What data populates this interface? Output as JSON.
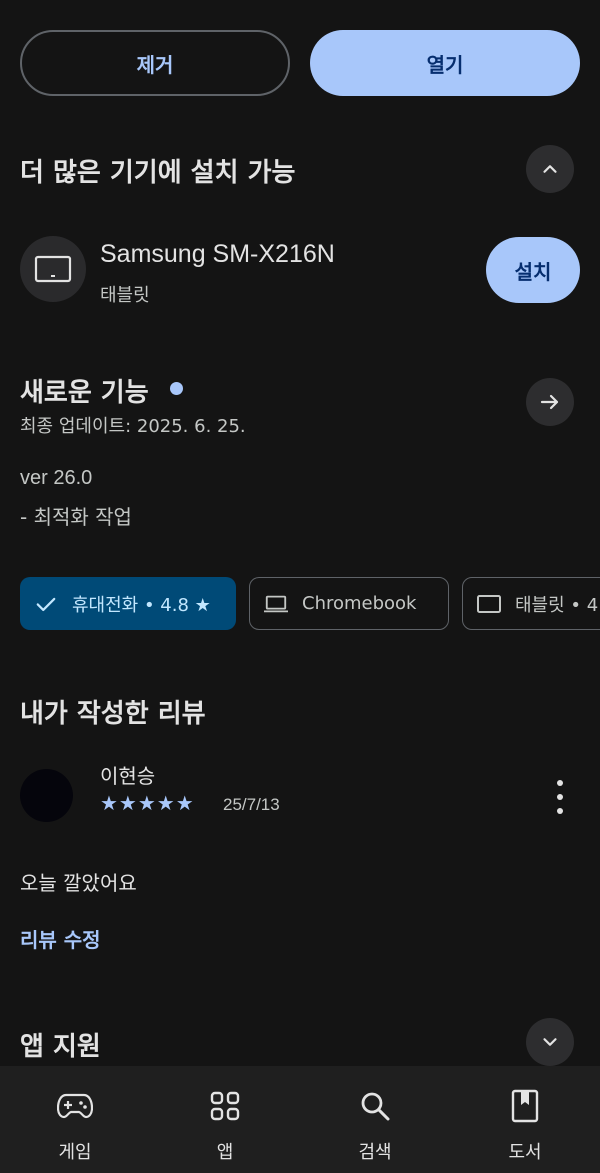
{
  "actions": {
    "remove_label": "제거",
    "open_label": "열기"
  },
  "more_devices": {
    "title": "더 많은 기기에 설치 가능",
    "device": {
      "name": "Samsung SM-X216N",
      "type": "태블릿",
      "install_label": "설치"
    }
  },
  "whats_new": {
    "title": "새로운 기능",
    "updated": "최종 업데이트: 2025. 6. 25.",
    "version": "ver 26.0",
    "note": "- 최적화 작업"
  },
  "rating_chips": [
    {
      "label": "휴대전화 • 4.8 ★",
      "icon": "check-icon",
      "selected": true
    },
    {
      "label": "Chromebook",
      "icon": "laptop-icon",
      "selected": false
    },
    {
      "label": "태블릿 • 4.",
      "icon": "tablet-icon",
      "selected": false
    }
  ],
  "my_review": {
    "title": "내가 작성한 리뷰",
    "author": "이현승",
    "stars": "★★★★★",
    "rating": 5,
    "date": "25/7/13",
    "text": "오늘 깔았어요",
    "edit_label": "리뷰 수정"
  },
  "app_support": {
    "title": "앱 지원"
  },
  "bottom_nav": [
    {
      "label": "게임",
      "icon": "gamepad-icon"
    },
    {
      "label": "앱",
      "icon": "apps-grid-icon"
    },
    {
      "label": "검색",
      "icon": "search-icon"
    },
    {
      "label": "도서",
      "icon": "book-icon"
    }
  ],
  "colors": {
    "accent": "#a8c7fa",
    "background": "#141414",
    "chip_selected": "#004a77"
  }
}
